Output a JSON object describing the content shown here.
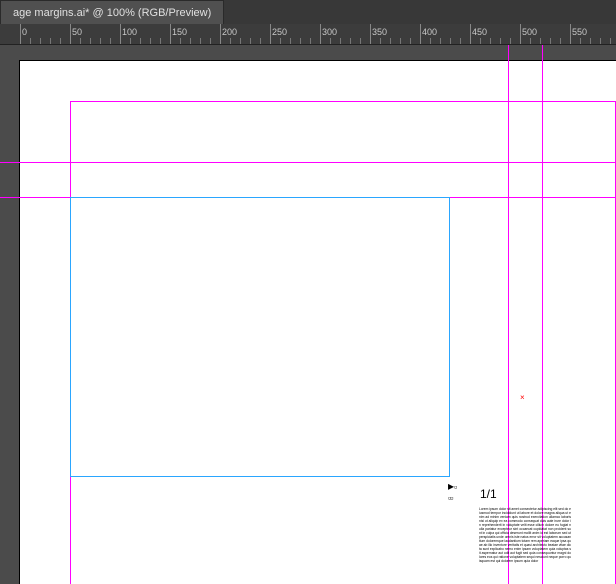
{
  "tab": {
    "title": "age margins.ai* @ 100% (RGB/Preview)"
  },
  "ruler": {
    "major_labels": [
      "0",
      "50",
      "100",
      "150",
      "200",
      "250",
      "300",
      "350",
      "400",
      "450",
      "500",
      "550"
    ]
  },
  "thread": {
    "count": "1/1"
  },
  "placeholder_text": "Lorem ipsum dolor sit amet consectetur adipiscing elit sed do eiusmod tempor incididunt ut labore et dolore magna aliqua ut enim ad minim veniam quis nostrud exercitation ullamco laboris nisi ut aliquip ex ea commodo consequat duis aute irure dolor in reprehenderit in voluptate velit esse cillum dolore eu fugiat nulla pariatur excepteur sint occaecat cupidatat non proident sunt in culpa qui officia deserunt mollit anim id est laborum sed ut perspiciatis unde omnis iste natus error sit voluptatem accusantium doloremque laudantium totam rem aperiam eaque ipsa quae ab illo inventore veritatis et quasi architecto beatae vitae dicta sunt explicabo nemo enim ipsam voluptatem quia voluptas sit aspernatur aut odit aut fugit sed quia consequuntur magni dolores eos qui ratione voluptatem sequi nesciunt neque porro quisquam est qui dolorem ipsum quia dolor"
}
